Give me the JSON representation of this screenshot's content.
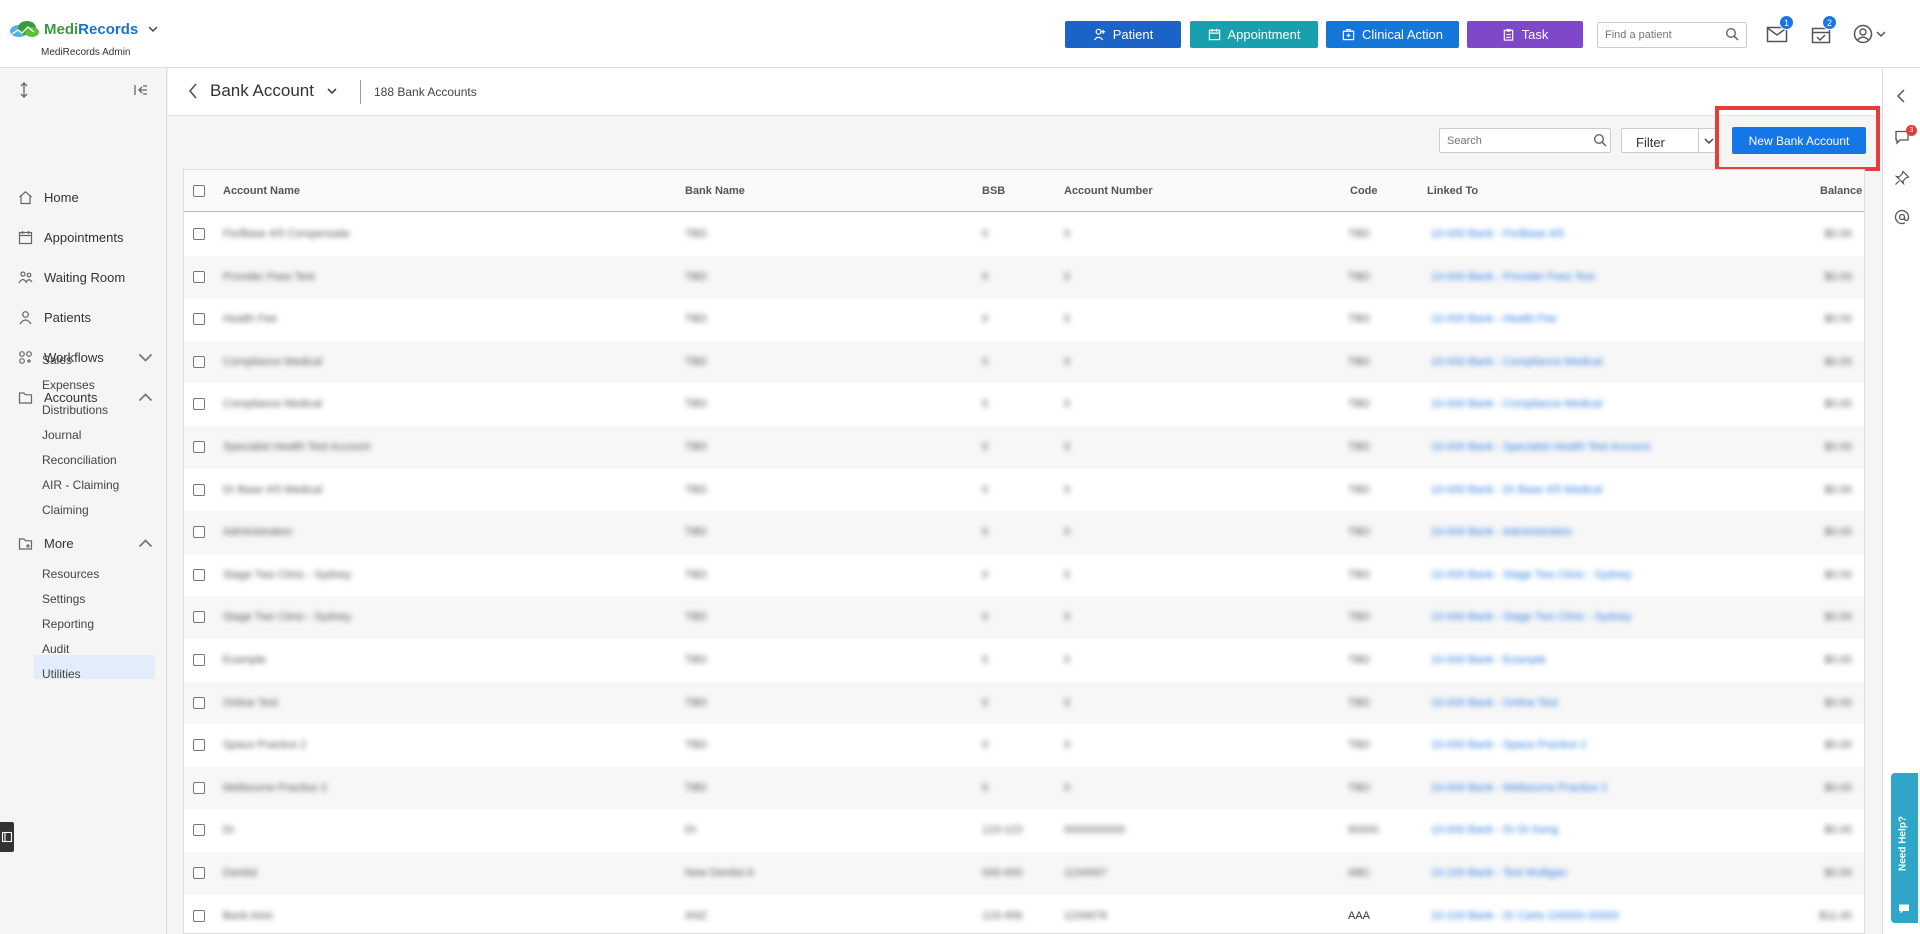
{
  "app": {
    "brand_medi": "Medi",
    "brand_records": "Records",
    "subtitle": "MediRecords Admin",
    "accent": "#1576e8"
  },
  "topbar": {
    "patient_label": "Patient",
    "appointment_label": "Appointment",
    "clinical_action_label": "Clinical Action",
    "task_label": "Task",
    "find_placeholder": "Find a patient",
    "messages_badge": "1",
    "tasks_badge": "2"
  },
  "sidebar": {
    "items": [
      {
        "label": "Home",
        "icon": "home-icon"
      },
      {
        "label": "Appointments",
        "icon": "calendar-icon"
      },
      {
        "label": "Waiting Room",
        "icon": "waiting-room-icon"
      },
      {
        "label": "Patients",
        "icon": "patients-icon"
      },
      {
        "label": "Workflows",
        "icon": "workflows-icon"
      },
      {
        "label": "Accounts",
        "icon": "folder-icon"
      },
      {
        "label": "More",
        "icon": "folder-plus-icon"
      }
    ],
    "accounts_sub": [
      "Sales",
      "Expenses",
      "Distributions",
      "Journal",
      "Reconciliation",
      "AIR - Claiming",
      "Claiming"
    ],
    "more_sub": [
      "Resources",
      "Settings",
      "Reporting",
      "Audit",
      "Utilities"
    ],
    "active_sub": "Settings"
  },
  "page": {
    "title": "Bank Account",
    "count": "188 Bank Accounts",
    "search_placeholder": "Search",
    "filter_label": "Filter",
    "new_button": "New Bank Account"
  },
  "table": {
    "columns": [
      "Account Name",
      "Bank Name",
      "BSB",
      "Account Number",
      "Code",
      "Linked To",
      "Balance"
    ],
    "rows": [
      [
        "Fix/Base 4/5 Compensate",
        "TBD",
        "0",
        "0",
        "TBD",
        "10-000 Bank - Fix/Base 4/5",
        "$0.00"
      ],
      [
        "Provider Fees Test",
        "TBD",
        "0",
        "0",
        "TBD",
        "10-000 Bank - Provider Fees Test",
        "$0.00"
      ],
      [
        "Health Fee",
        "TBD",
        "0",
        "0",
        "TBD",
        "10-000 Bank - Health Fee",
        "$0.00"
      ],
      [
        "Compliance Medical",
        "TBD",
        "0",
        "0",
        "TBD",
        "10-000 Bank - Compliance Medical",
        "$0.00"
      ],
      [
        "Compliance Medical",
        "TBD",
        "0",
        "0",
        "TBD",
        "10-000 Bank - Compliance Medical",
        "$0.00"
      ],
      [
        "Specialist Health Test Account",
        "TBD",
        "0",
        "0",
        "TBD",
        "10-000 Bank - Specialist Health Test Account",
        "$0.00"
      ],
      [
        "Dr Base 4/5 Medical",
        "TBD",
        "0",
        "0",
        "TBD",
        "10-000 Bank - Dr Base 4/5 Medical",
        "$0.00"
      ],
      [
        "Administration",
        "TBD",
        "0",
        "0",
        "TBD",
        "10-000 Bank - Administration",
        "$0.00"
      ],
      [
        "Stage Two Clinic - Sydney",
        "TBD",
        "0",
        "0",
        "TBD",
        "10-000 Bank - Stage Two Clinic - Sydney",
        "$0.00"
      ],
      [
        "Stage Two Clinic - Sydney",
        "TBD",
        "0",
        "0",
        "TBD",
        "10-000 Bank - Stage Two Clinic - Sydney",
        "$0.00"
      ],
      [
        "Example",
        "TBD",
        "0",
        "0",
        "TBD",
        "10-000 Bank - Example",
        "$0.00"
      ],
      [
        "Online Test",
        "TBD",
        "0",
        "0",
        "TBD",
        "10-000 Bank - Online Test",
        "$0.00"
      ],
      [
        "Space Practice 2",
        "TBD",
        "0",
        "0",
        "TBD",
        "10-000 Bank - Space Practice 2",
        "$0.00"
      ],
      [
        "Melbourne Practice 2",
        "TBD",
        "0",
        "0",
        "TBD",
        "10-000 Bank - Melbourne Practice 2",
        "$0.00"
      ],
      [
        "Dr",
        "Dr",
        "123-123",
        "0000000000",
        "90000",
        "10-000 Bank - Dr Dr Keng",
        "$0.00"
      ],
      [
        "Dentist",
        "New Dentist A",
        "000-000",
        "1234567",
        "ABC",
        "10-100 Bank - Test Mulligan",
        "$0.00"
      ],
      [
        "Bank AAA",
        "ANZ",
        "123-456",
        "1234678",
        "AAA",
        "10-100 Bank - Dr Carlo-100000-20000",
        "$11.00"
      ]
    ]
  }
}
